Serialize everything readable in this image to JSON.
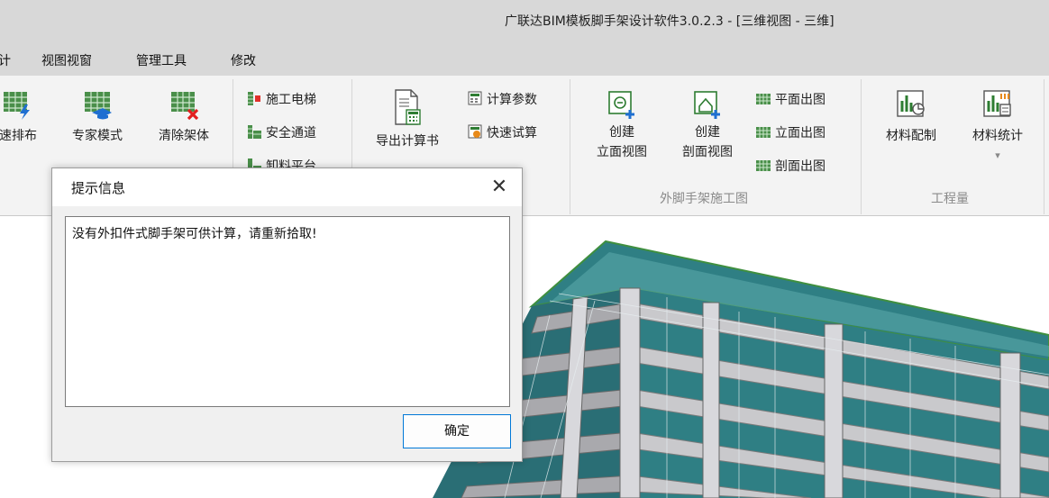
{
  "window": {
    "title": "广联达BIM模板脚手架设计软件3.0.2.3 - [三维视图 - 三维]"
  },
  "menu": {
    "items": [
      "计",
      "视图视窗",
      "管理工具",
      "修改"
    ]
  },
  "ribbon": {
    "big_buttons": [
      "速排布",
      "专家模式",
      "清除架体",
      "导出计算书",
      "材料配制",
      "材料统计"
    ],
    "create_elevation": {
      "line1": "创建",
      "line2": "立面视图"
    },
    "create_section": {
      "line1": "创建",
      "line2": "剖面视图"
    },
    "small_buttons": {
      "elevator": "施工电梯",
      "safe_passage": "安全通道",
      "platform": "卸料平台",
      "calc_params": "计算参数",
      "quick_calc": "快速试算",
      "plan_drawing": "平面出图",
      "elevation_drawing": "立面出图",
      "section_drawing": "剖面出图"
    },
    "groups": {
      "construction_drawing": "外脚手架施工图",
      "quantity": "工程量"
    },
    "more_arrow": "▾"
  },
  "dialog": {
    "title": "提示信息",
    "close": "✕",
    "message": "没有外扣件式脚手架可供计算，请重新拾取!",
    "ok_label": "确定"
  },
  "colors": {
    "accent": "#0078d7",
    "icon_green": "#2e7d32",
    "glass": "#2f7f84",
    "scaffold_green": "#3f8f3f"
  }
}
